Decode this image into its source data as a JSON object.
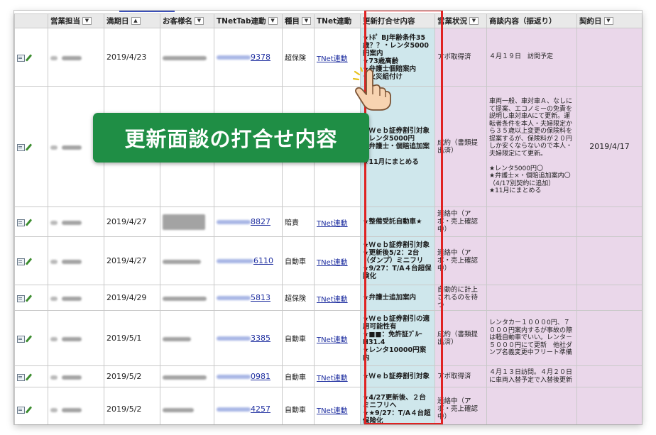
{
  "headers": [
    "",
    "営業担当",
    "満期日",
    "お客様名",
    "TNetTab連動",
    "種目",
    "TNet連動",
    "更新打合せ内容",
    "営業状況",
    "商談内容（振返り）",
    "契約日"
  ],
  "sort_marks": [
    "▼",
    "▲",
    "▼",
    "▼",
    "▼",
    "",
    "",
    "▼",
    "",
    "▼"
  ],
  "rows": [
    {
      "date": "2019/4/23",
      "num": "9378",
      "kind": "超保険",
      "link": "TNet連動",
      "update": "★ﾄﾎﾟ BJ年齢条件35歳？？・レンタ5000円案内\n★73歳高齢\n★弁護士個賠案内\n★火災組付け",
      "status": "アポ取得済",
      "memo": "４月１９日　訪問予定",
      "contract": ""
    },
    {
      "date": "",
      "num": "",
      "kind": "",
      "link": "",
      "update": "★Ｗｅｂ証券割引対象\n★レンタ5000円\n★弁護士・個賠追加案内\n★11月にまとめる",
      "status": "成約（書類提出済）",
      "memo": "車両一般、車対車Ａ、なしにて提案、エコノミーの免責を説明し車対車Aにて更新。運転者条件を本人・夫婦限定から３５歳以上変更の保険料を提案するが、保険料が２０円しか安くならないので本人・夫婦限定にて更新。\n\n★レンタ5000円〇\n★弁護士×・個賠追加案内〇（4/17別契約に追加）\n★11月にまとめる",
      "contract": "2019/4/17"
    },
    {
      "date": "2019/4/27",
      "num": "8827",
      "kind": "賠責",
      "link": "TNet連動",
      "update": "★整備受託自動車★",
      "status": "連絡中（アポ・売上確認中）",
      "memo": "",
      "contract": ""
    },
    {
      "date": "2019/4/27",
      "num": "6110",
      "kind": "自動車",
      "link": "TNet連動",
      "update": "★Ｗｅｂ証券割引対象\n★更新後5/2：2台（ダンプ）ミニフリ\n★9/27：T/A４台超保険化",
      "status": "連絡中（アポ・売上確認中）",
      "memo": "",
      "contract": ""
    },
    {
      "date": "2019/4/29",
      "num": "5813",
      "kind": "超保険",
      "link": "TNet連動",
      "update": "★弁護士追加案内",
      "status": "自動的に計上されるのを待つ",
      "memo": "",
      "contract": ""
    },
    {
      "date": "2019/5/1",
      "num": "3385",
      "kind": "自動車",
      "link": "TNet連動",
      "update": "★Ｗｅｂ証券割引の適用可能性有\n★■■：免許証ﾌﾞﾙｰH31.4\n★レンタ10000円案内",
      "status": "成約（書類提出済）",
      "memo": "レンタカー１０００0円、７０００円案内するが事故の際は軽自動車でいい。レンタ－５０００円にて更新　他社ダンプ名義変更中フリート準備",
      "contract": ""
    },
    {
      "date": "2019/5/2",
      "num": "0981",
      "kind": "自動車",
      "link": "TNet連動",
      "update": "★Ｗｅｂ証券割引対象",
      "status": "アポ取得済",
      "memo": "４月１３日訪問。４月２０日に車両入替予定で入替後更新",
      "contract": ""
    },
    {
      "date": "2019/5/2",
      "num": "4257",
      "kind": "自動車",
      "link": "TNet連動",
      "update": "★4/27更新後、２台ミニフリへ\n★★9/27：T/A４台超保険化",
      "status": "連絡中（アポ・売上確認中）",
      "memo": "",
      "contract": ""
    }
  ],
  "overlay_text": "更新面談の打合せ内容",
  "colors": {
    "update_col": "#cfe7ec",
    "status_col": "#ead7ea",
    "highlight": "#e02222",
    "overlay_bg": "#1f8e45",
    "link": "#1f2fa0"
  },
  "icons": [
    "view-icon",
    "edit-pencil-icon",
    "pointing-hand-icon"
  ]
}
